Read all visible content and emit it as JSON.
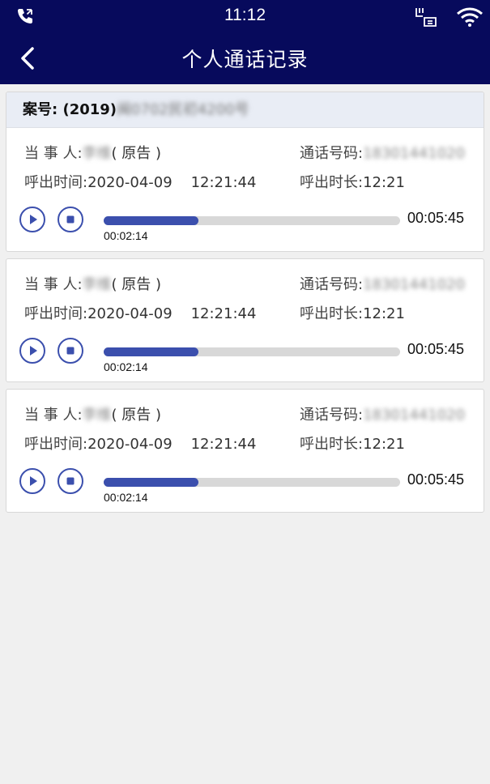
{
  "status": {
    "time": "11:12"
  },
  "nav": {
    "title": "个人通话记录"
  },
  "case": {
    "label": "案号:",
    "number_visible": "(2019)",
    "number_blurred": "闽0702民初4200号"
  },
  "labels": {
    "party": "当 事 人:",
    "phone": "通话号码:",
    "call_out_time": "呼出时间:",
    "call_duration": "呼出时长:"
  },
  "records": [
    {
      "party_name": "李维",
      "party_role": "( 原告 )",
      "phone": "18301441020",
      "date": "2020-04-09",
      "time": "12:21:44",
      "duration": "12:21",
      "current": "00:02:14",
      "total": "00:05:45",
      "progress": 0.32
    },
    {
      "party_name": "李维",
      "party_role": "( 原告 )",
      "phone": "18301441020",
      "date": "2020-04-09",
      "time": "12:21:44",
      "duration": "12:21",
      "current": "00:02:14",
      "total": "00:05:45",
      "progress": 0.32
    },
    {
      "party_name": "李维",
      "party_role": "( 原告 )",
      "phone": "18301441020",
      "date": "2020-04-09",
      "time": "12:21:44",
      "duration": "12:21",
      "current": "00:02:14",
      "total": "00:05:45",
      "progress": 0.32
    }
  ],
  "icons": {
    "back": "chevron-left-icon",
    "play": "play-icon",
    "stop": "stop-icon",
    "phone": "phone-call-icon",
    "sim": "sim-icon",
    "wifi": "wifi-icon"
  },
  "colors": {
    "header_bg": "#070a5c",
    "accent": "#3b4fad",
    "track": "#d8d8d8"
  }
}
